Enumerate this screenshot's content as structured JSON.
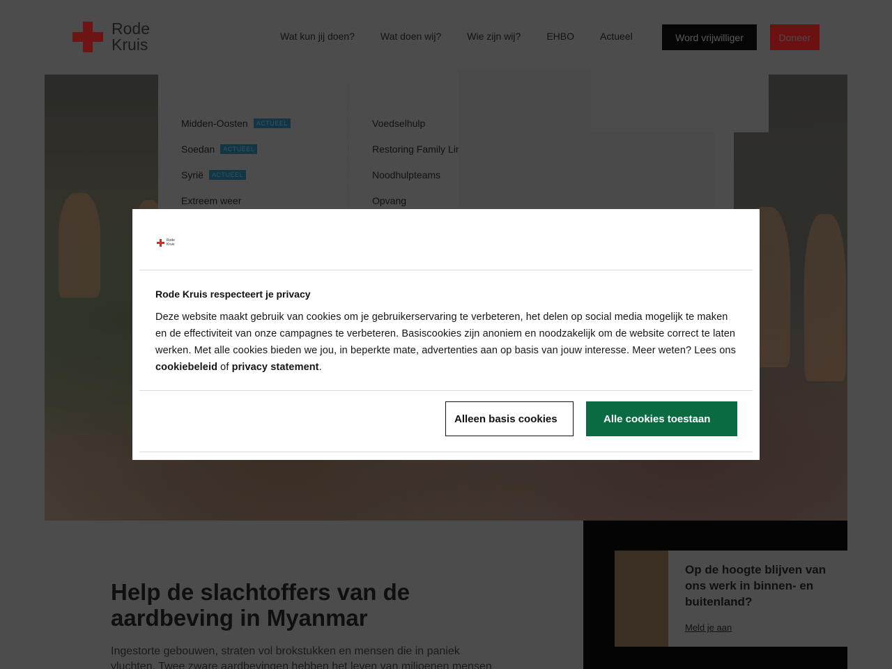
{
  "brand": {
    "line1": "Rode",
    "line2": "Kruis",
    "accent": "#d62b2b"
  },
  "nav": {
    "items": [
      "Wat kun jij doen?",
      "Wat doen wij?",
      "Wie zijn wij?",
      "EHBO",
      "Actueel"
    ],
    "volunteer_label": "Word vrijwilliger",
    "donate_label": "Doneer"
  },
  "mega_menu": {
    "column1": [
      {
        "label": "Midden-Oosten",
        "badge": "ACTUEEL"
      },
      {
        "label": "Soedan",
        "badge": "ACTUEEL"
      },
      {
        "label": "Syrië",
        "badge": "ACTUEEL"
      },
      {
        "label": "Extreem weer",
        "badge": ""
      }
    ],
    "column2": [
      {
        "label": "Voedselhulp"
      },
      {
        "label": "Restoring Family Lin"
      },
      {
        "label": "Noodhulpteams"
      },
      {
        "label": "Opvang"
      }
    ]
  },
  "content": {
    "headline": "Help de slachtoffers van de aardbeving in Myanmar",
    "intro": "Ingestorte gebouwen, straten vol brokstukken en mensen die in paniek vluchten. Twee zware aardbevingen hebben het leven van miljoenen mensen"
  },
  "newsletter": {
    "title": "Op de hoogte blijven van ons werk in binnen- en buitenland?",
    "link": "Meld je aan"
  },
  "cookie_modal": {
    "logo_line1": "Rode",
    "logo_line2": "Kruis",
    "title": "Rode Kruis respecteert je privacy",
    "body_text": "Deze website maakt gebruik van cookies om je gebruikerservaring te verbeteren, het delen op social media mogelijk te maken en de effectiviteit van onze campagnes te verbeteren. Basiscookies zijn anoniem en noodzakelijk om de website correct te laten werken. Met alle cookies bieden we jou, in beperkte mate, advertenties aan op basis van jouw interesse. Meer weten? Lees ons ",
    "link_cookie": "cookiebeleid",
    "connector": " of ",
    "link_privacy": "privacy statement",
    "period": ".",
    "btn_basic": "Alleen basis cookies",
    "btn_all": "Alle cookies toestaan",
    "primary_color": "#0a6b42"
  }
}
